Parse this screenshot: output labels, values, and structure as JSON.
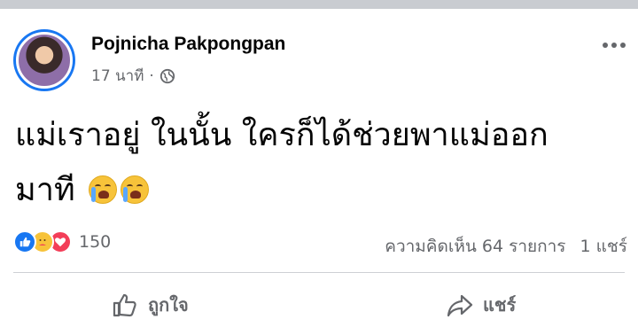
{
  "post": {
    "author": "Pojnicha Pakpongpan",
    "time": "17 นาที",
    "separator": "·",
    "privacy_icon": "globe-icon",
    "text_line1": "แม่เราอยู่ ในนั้น ใครก็ได้ช่วยพาแม่ออก",
    "text_line2": "มาที",
    "emojis": [
      "crying-face",
      "crying-face"
    ]
  },
  "reactions": {
    "icons": [
      "like-icon",
      "care-icon",
      "love-icon"
    ],
    "count": "150"
  },
  "stats": {
    "comments": "ความคิดเห็น 64 รายการ",
    "shares": "1 แชร์"
  },
  "actions": {
    "like_label": "ถูกใจ",
    "share_label": "แชร์"
  },
  "colors": {
    "accent": "#1877f2",
    "text_secondary": "#65676b",
    "love": "#f33e58",
    "care": "#f7c33a"
  }
}
